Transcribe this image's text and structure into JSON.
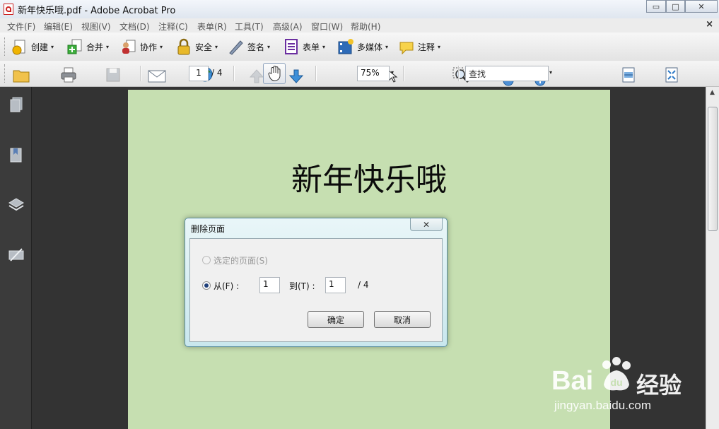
{
  "window": {
    "title": "新年快乐哦.pdf - Adobe Acrobat Pro",
    "controls": {
      "minimize": "▭",
      "maximize": "□",
      "close": "✕"
    }
  },
  "menubar": {
    "items": [
      "文件(F)",
      "编辑(E)",
      "视图(V)",
      "文档(D)",
      "注释(C)",
      "表单(R)",
      "工具(T)",
      "高级(A)",
      "窗口(W)",
      "帮助(H)"
    ],
    "close_doc": "×"
  },
  "toolbar1": {
    "items": [
      {
        "label": "创建",
        "icon": "create-icon"
      },
      {
        "label": "合并",
        "icon": "combine-icon"
      },
      {
        "label": "协作",
        "icon": "collaborate-icon"
      },
      {
        "label": "安全",
        "icon": "lock-icon"
      },
      {
        "label": "签名",
        "icon": "pen-icon"
      },
      {
        "label": "表单",
        "icon": "form-icon"
      },
      {
        "label": "多媒体",
        "icon": "multimedia-icon"
      },
      {
        "label": "注释",
        "icon": "comment-icon"
      }
    ],
    "caret": "▾"
  },
  "toolbar2": {
    "page_value": "1",
    "page_total": "/ 4",
    "zoom_value": "75%",
    "search_placeholder": "查找"
  },
  "document": {
    "heading": "新年快乐哦",
    "page_color": "#c6dfb1"
  },
  "dialog": {
    "title": "删除页面",
    "close_label": "✕",
    "option_selected_pages": "选定的页面(S)",
    "option_from": "从(F) :",
    "from_value": "1",
    "to_label": "到(T) :",
    "to_value": "1",
    "total": "/ 4",
    "ok_label": "确定",
    "cancel_label": "取消"
  },
  "watermark": {
    "brand": "Bai",
    "brand2": "经验",
    "url": "jingyan.baidu.com"
  }
}
